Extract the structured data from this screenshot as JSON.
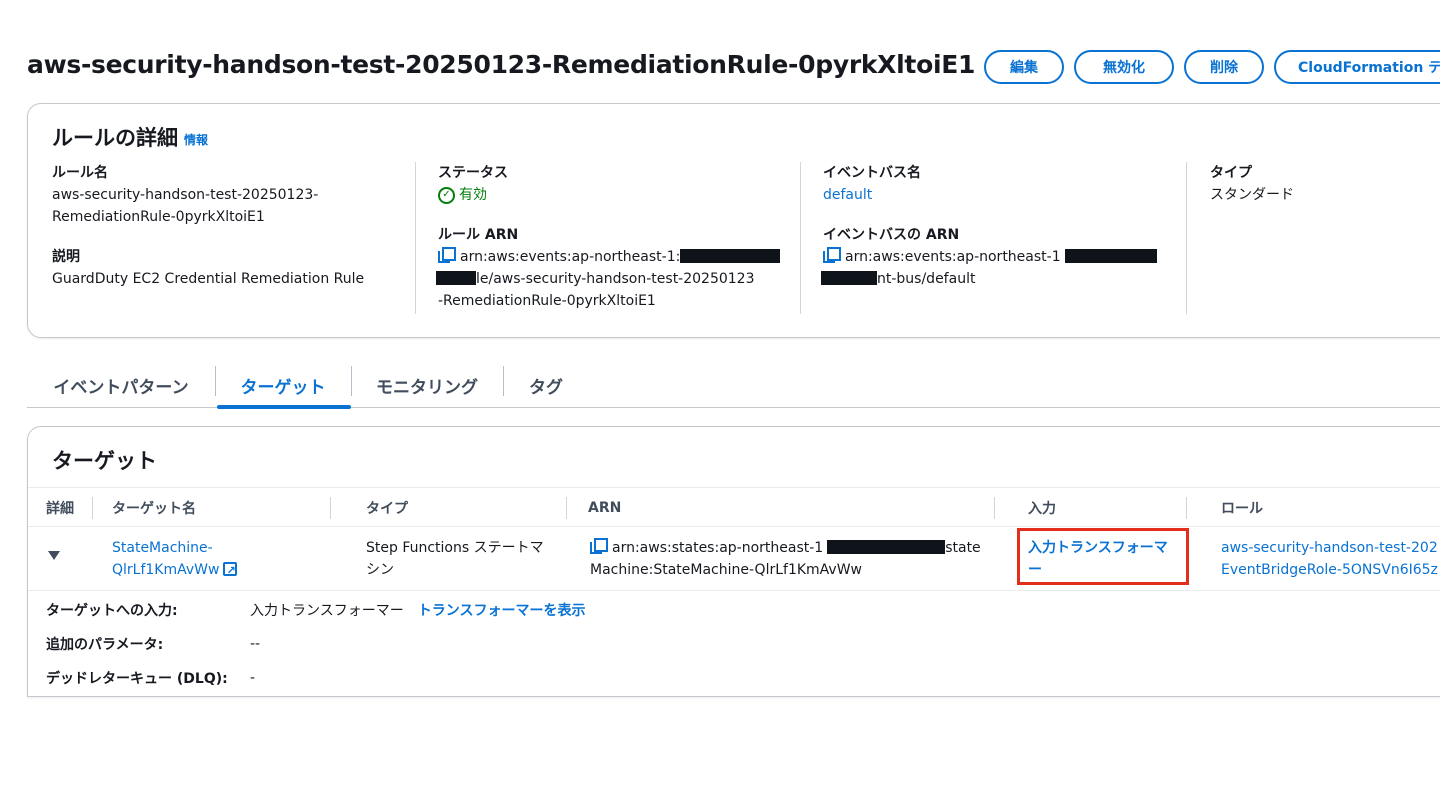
{
  "header": {
    "title": "aws-security-handson-test-20250123-RemediationRule-0pyrkXltoiE1",
    "actions": {
      "edit": "編集",
      "disable": "無効化",
      "delete": "削除",
      "cloudformation": "CloudFormation テ"
    }
  },
  "rule_details": {
    "title": "ルールの詳細",
    "info": "情報",
    "rule_name": {
      "label": "ルール名",
      "value_line1": "aws-security-handson-test-20250123-",
      "value_line2": "RemediationRule-0pyrkXltoiE1"
    },
    "description": {
      "label": "説明",
      "value": "GuardDuty EC2 Credential Remediation Rule"
    },
    "status": {
      "label": "ステータス",
      "value": "有効"
    },
    "rule_arn": {
      "label": "ルール ARN",
      "line1": "arn:aws:events:ap-northeast-1:",
      "line2": "le/aws-security-handson-test-20250123",
      "line3": "-RemediationRule-0pyrkXltoiE1"
    },
    "event_bus_name": {
      "label": "イベントバス名",
      "value": "default"
    },
    "event_bus_arn": {
      "label": "イベントバスの ARN",
      "line1": "arn:aws:events:ap-northeast-1",
      "line2": "nt-bus/default"
    },
    "type": {
      "label": "タイプ",
      "value": "スタンダード"
    }
  },
  "tabs": [
    {
      "label": "イベントパターン"
    },
    {
      "label": "ターゲット"
    },
    {
      "label": "モニタリング"
    },
    {
      "label": "タグ"
    }
  ],
  "targets": {
    "title": "ターゲット",
    "columns": {
      "details": "詳細",
      "target_name": "ターゲット名",
      "type": "タイプ",
      "arn": "ARN",
      "input": "入力",
      "role": "ロール"
    },
    "row": {
      "target_name_line1": "StateMachine-",
      "target_name_line2": "QlrLf1KmAvWw",
      "type_line1": "Step Functions ステートマ",
      "type_line2": "シン",
      "arn_line1a": "arn:aws:states:ap-northeast-1",
      "arn_line1b": "state",
      "arn_line2": "Machine:StateMachine-QlrLf1KmAvWw",
      "input_line1": "入力トランスフォーマ",
      "input_line2": "ー",
      "role_line1": "aws-security-handson-test-202",
      "role_line2": "EventBridgeRole-5ONSVn6I65z"
    },
    "expanded": {
      "input_label": "ターゲットへの入力:",
      "input_value": "入力トランスフォーマー",
      "input_link": "トランスフォーマーを表示",
      "params_label": "追加のパラメータ:",
      "params_value": "--",
      "dlq_label": "デッドレターキュー (DLQ):",
      "dlq_value": "-"
    }
  },
  "colors": {
    "link": "#0972d3",
    "success": "#037f0c",
    "highlight": "#e32d1d",
    "redaction": "#0f141a"
  }
}
